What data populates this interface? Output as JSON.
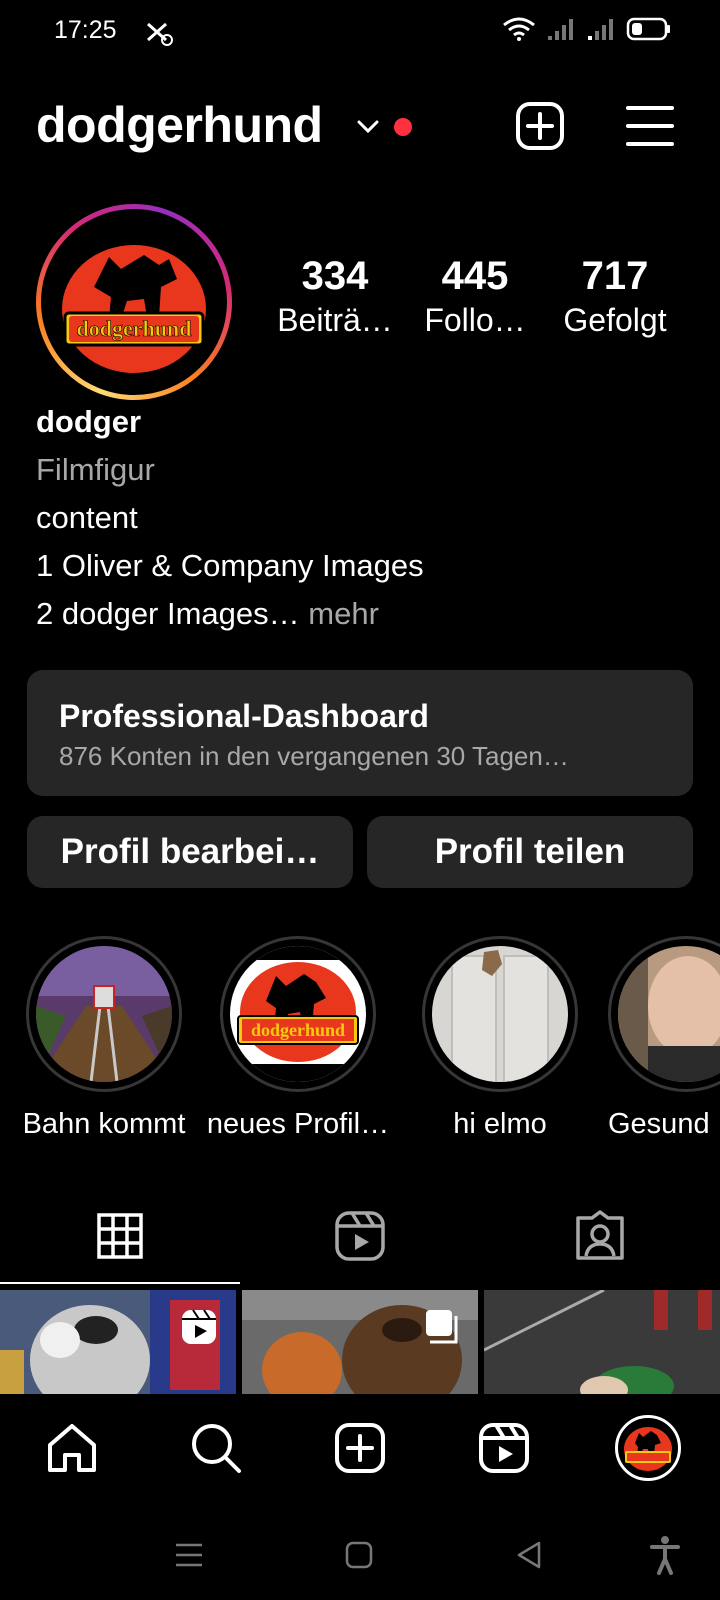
{
  "status_bar": {
    "time": "17:25",
    "left_icon": "scissors-gear-icon",
    "right_icons": [
      "wifi-icon",
      "signal-icon",
      "signal-icon",
      "battery-icon"
    ]
  },
  "header": {
    "username": "dodgerhund",
    "icons": [
      "chevron-down-icon",
      "notification-dot",
      "plus-square-icon",
      "hamburger-menu-icon"
    ]
  },
  "profile": {
    "avatar_logo_text": "dodgerhund",
    "stats": [
      {
        "value": "334",
        "label": "Beiträ…"
      },
      {
        "value": "445",
        "label": "Follo…"
      },
      {
        "value": "717",
        "label": "Gefolgt"
      }
    ],
    "bio": {
      "name": "dodger",
      "category": "Filmfigur",
      "lines": [
        "content",
        "1 Oliver & Company Images"
      ],
      "last_line": "2 dodger Images…",
      "more": " mehr"
    }
  },
  "dashboard": {
    "title": "Professional-Dashboard",
    "subtitle": "876 Konten in den vergangenen 30 Tagen…"
  },
  "buttons": {
    "edit": "Profil bearbei…",
    "share": "Profil teilen"
  },
  "highlights": [
    {
      "label": "Bahn kommt"
    },
    {
      "label": "neues Profil…"
    },
    {
      "label": "hi elmo"
    },
    {
      "label": "Gesund"
    }
  ],
  "tabs": [
    "grid-icon",
    "reels-icon",
    "tagged-icon"
  ],
  "bottom_nav": [
    "home-icon",
    "search-icon",
    "create-icon",
    "reels-icon",
    "profile-avatar"
  ],
  "system_nav": [
    "menu-icon",
    "home-square-icon",
    "back-icon",
    "accessibility-icon"
  ],
  "colors": {
    "background": "#000000",
    "card": "#262626",
    "secondary_text": "#a8a8a8",
    "notification": "#ff3040",
    "logo_red": "#e8371d"
  }
}
